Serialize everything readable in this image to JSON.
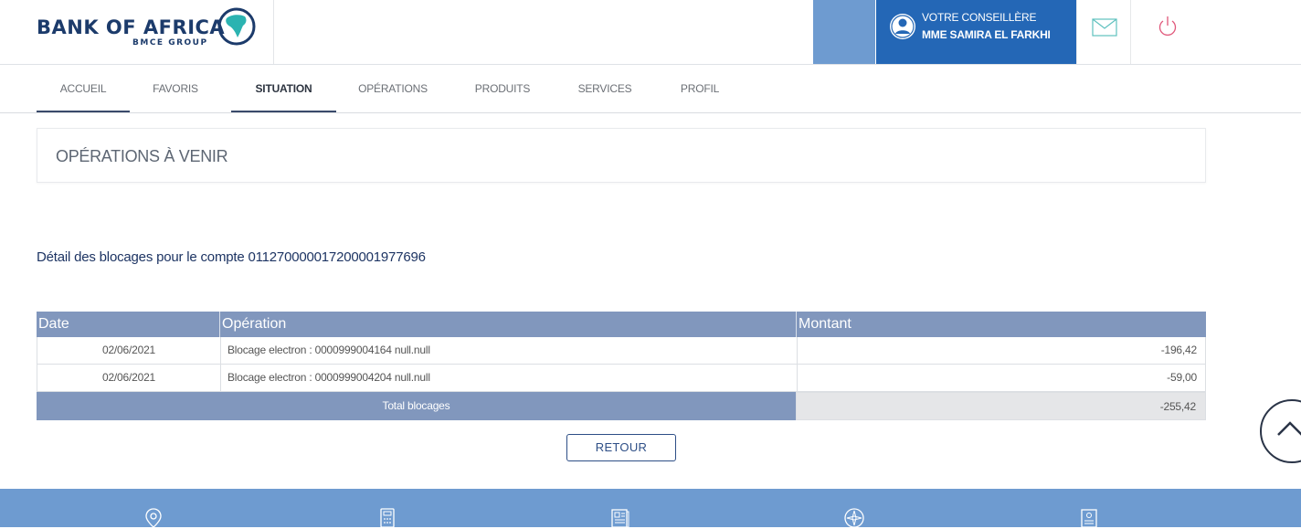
{
  "brand": {
    "name": "BANK OF AFRICA",
    "group": "BMCE GROUP",
    "colors": {
      "navy": "#1c3b6b",
      "teal": "#2bb3b1",
      "header_blue": "#2467b6",
      "light_blue": "#6e9bd0",
      "table_head": "#8197bd"
    }
  },
  "advisor": {
    "label": "VOTRE CONSEILLÈRE",
    "name": "MME SAMIRA EL FARKHI",
    "avatar_icon": "user-circle-icon"
  },
  "header_icons": {
    "mail": "envelope-icon",
    "logout": "power-icon"
  },
  "nav": {
    "items": [
      {
        "label": "ACCUEIL",
        "active": false,
        "underline": true
      },
      {
        "label": "FAVORIS",
        "active": false,
        "underline": false
      },
      {
        "label": "SITUATION",
        "active": true,
        "underline": true
      },
      {
        "label": "OPÉRATIONS",
        "active": false,
        "underline": false
      },
      {
        "label": "PRODUITS",
        "active": false,
        "underline": false
      },
      {
        "label": "SERVICES",
        "active": false,
        "underline": false
      },
      {
        "label": "PROFIL",
        "active": false,
        "underline": false
      }
    ]
  },
  "section": {
    "title": "OPÉRATIONS À VENIR"
  },
  "detail": {
    "text": "Détail des blocages pour le compte 011270000017200001977696"
  },
  "table": {
    "headers": [
      "Date",
      "Opération",
      "Montant"
    ],
    "rows": [
      {
        "date": "02/06/2021",
        "operation": "Blocage electron : 0000999004164 null.null",
        "amount": "-196,42"
      },
      {
        "date": "02/06/2021",
        "operation": "Blocage electron : 0000999004204 null.null",
        "amount": "-59,00"
      }
    ],
    "total_label": "Total blocages",
    "total_value": "-255,42"
  },
  "actions": {
    "retour": "RETOUR",
    "scroll_top_icon": "chevron-up-icon"
  },
  "footer": {
    "icons": [
      "location-pin-icon",
      "calculator-icon",
      "document-icon",
      "compass-icon",
      "contact-card-icon"
    ]
  }
}
